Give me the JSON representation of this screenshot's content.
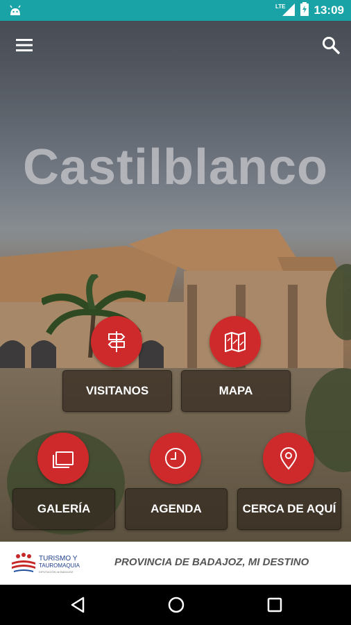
{
  "status_bar": {
    "time": "13:09",
    "network": "LTE",
    "icons": [
      "android-icon",
      "lte-signal-icon",
      "battery-charging-icon"
    ]
  },
  "header": {
    "menu_icon": "hamburger-menu-icon",
    "search_icon": "search-icon"
  },
  "hero": {
    "title": "Castilblanco"
  },
  "tiles": [
    {
      "label": "VISITANOS",
      "icon": "signpost-icon"
    },
    {
      "label": "MAPA",
      "icon": "map-icon"
    },
    {
      "label": "GALERÍA",
      "icon": "gallery-icon"
    },
    {
      "label": "AGENDA",
      "icon": "clock-icon"
    },
    {
      "label": "CERCA DE AQUÍ",
      "icon": "location-pin-icon"
    }
  ],
  "colors": {
    "status_bar": "#1aa3a6",
    "accent_red": "#cf2a2b"
  },
  "footer": {
    "logo_text": "TURISMO Y TAUROMAQUIA",
    "logo_subtext": "DIPUTACIÓN de BADAJOZ",
    "slogan": "PROVINCIA DE BADAJOZ, MI DESTINO"
  },
  "nav_bar": {
    "buttons": [
      "back-icon",
      "home-icon",
      "recents-icon"
    ]
  }
}
